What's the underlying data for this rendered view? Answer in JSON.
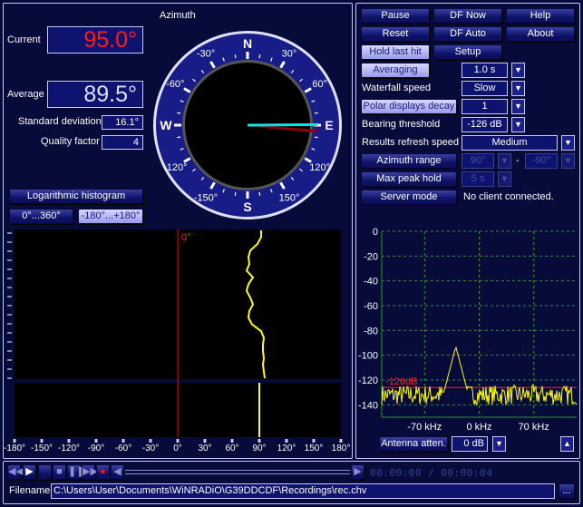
{
  "azimuth": {
    "title": "Azimuth",
    "current_label": "Current",
    "current_value": "95.0°",
    "average_label": "Average",
    "average_value": "89.5°",
    "stddev_label": "Standard deviation",
    "stddev_value": "16.1°",
    "quality_label": "Quality factor",
    "quality_value": "4",
    "current_bearing_deg": 95.0,
    "average_bearing_deg": 89.5,
    "compass_cardinals": [
      "N",
      "E",
      "S",
      "W"
    ],
    "compass_labels": [
      "30°",
      "60°",
      "120°",
      "150°",
      "-150°",
      "-120°",
      "-60°",
      "-30°"
    ]
  },
  "histogram": {
    "log_button": "Logarithmic histogram",
    "range_0_360": "0°...360°",
    "range_pm180": "-180°...+180°",
    "zero_marker": "0°",
    "axis_ticks": [
      "-180°",
      "-150°",
      "-120°",
      "-90°",
      "-60°",
      "-30°",
      "0°",
      "30°",
      "60°",
      "90°",
      "120°",
      "150°",
      "180°"
    ],
    "waterfall_trace_deg": [
      92,
      92,
      88,
      80,
      78,
      79,
      76,
      83,
      78,
      76,
      80,
      83,
      79,
      78,
      82,
      92,
      95,
      94,
      94,
      95,
      94,
      95,
      96
    ],
    "histogram_peak_deg": 90
  },
  "controls": {
    "pause": "Pause",
    "df_now": "DF Now",
    "help": "Help",
    "reset": "Reset",
    "df_auto": "DF Auto",
    "about": "About",
    "hold_last_hit": "Hold last hit",
    "setup": "Setup",
    "averaging": "Averaging",
    "averaging_value": "1.0 s",
    "waterfall_speed": "Waterfall speed",
    "waterfall_speed_value": "Slow",
    "polar_decay": "Polar displays decay",
    "polar_decay_value": "1",
    "bearing_threshold": "Bearing threshold",
    "bearing_threshold_value": "-126 dB",
    "refresh_speed": "Results refresh speed",
    "refresh_speed_value": "Medium",
    "azimuth_range": "Azimuth range",
    "azimuth_range_from": "90°",
    "azimuth_range_sep": "-",
    "azimuth_range_to": "-90°",
    "max_peak_hold": "Max peak hold",
    "max_peak_hold_value": "5 s",
    "server_mode": "Server mode",
    "server_status": "No client connected."
  },
  "spectrum": {
    "y_ticks": [
      "0",
      "-20",
      "-40",
      "-60",
      "-80",
      "-100",
      "-120",
      "-140"
    ],
    "x_ticks": [
      "-70 kHz",
      "0 kHz",
      "70 kHz"
    ],
    "threshold_label": "-126dB",
    "threshold_db": -126,
    "peak_db": -93,
    "peak_khz": -30,
    "noise_floor_db": -132,
    "ylim": [
      -150,
      0
    ],
    "xlim_khz": [
      -125,
      125
    ],
    "antenna_atten_label": "Antenna atten.",
    "antenna_atten_value": "0 dB",
    "grid_color": "#1f9a1f",
    "trace_color": "#ffff00",
    "threshold_color": "#ff2020"
  },
  "player": {
    "time": "00:00:00 / 00:00:04",
    "filename_label": "Filename",
    "filename": "C:\\Users\\User\\Documents\\WiNRADiO\\G39DDCDF\\Recordings\\rec.chv",
    "browse": "..."
  }
}
